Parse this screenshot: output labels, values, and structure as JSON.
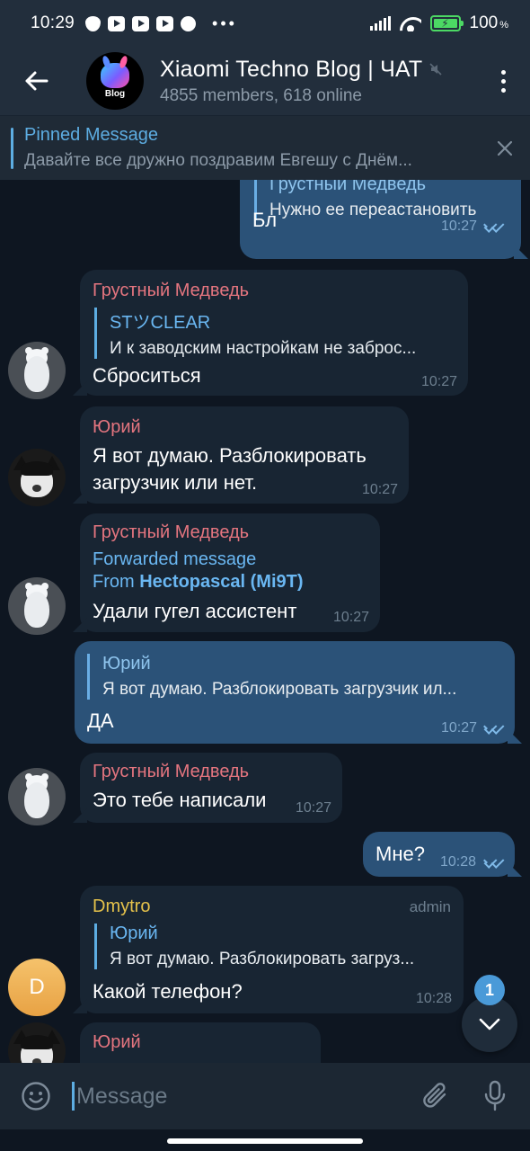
{
  "status_bar": {
    "time": "10:29",
    "battery": "100",
    "battery_unit": "%",
    "overflow": "•••"
  },
  "header": {
    "avatar_text": "Blog",
    "title": "Xiaomi Techno Blog | ЧАТ",
    "subtitle": "4855 members, 618 online"
  },
  "pinned": {
    "title": "Pinned Message",
    "preview": "Давайте все дружно поздравим Евгешу с Днём..."
  },
  "messages": [
    {
      "id": "m1",
      "direction": "out",
      "reply_name": "Грустный Медведь",
      "reply_text": "Нужно ее переастановить",
      "text": "Бл",
      "time": "10:27"
    },
    {
      "id": "m2",
      "direction": "in",
      "sender": "Грустный Медведь",
      "reply_name": "STツCLEAR",
      "reply_text": "И к заводским настройкам не заброс...",
      "text": "Сброситься",
      "time": "10:27"
    },
    {
      "id": "m3",
      "direction": "in",
      "sender": "Юрий",
      "text_line1": "Я вот думаю. Разблокировать",
      "text_line2": "загрузчик или нет.",
      "time": "10:27"
    },
    {
      "id": "m4",
      "direction": "in",
      "sender": "Грустный Медведь",
      "forward_label": "Forwarded message",
      "forward_from_prefix": "From",
      "forward_from_name": "Hectopascal (Mi9T)",
      "text": "Удали гугел ассистент",
      "time": "10:27"
    },
    {
      "id": "m5",
      "direction": "out",
      "reply_name": "Юрий",
      "reply_text": "Я вот думаю. Разблокировать загрузчик ил...",
      "text": "ДА",
      "time": "10:27"
    },
    {
      "id": "m6",
      "direction": "in",
      "sender": "Грустный Медведь",
      "text": "Это тебе написали",
      "time": "10:27"
    },
    {
      "id": "m7",
      "direction": "out",
      "text": "Мне?",
      "time": "10:28"
    },
    {
      "id": "m8",
      "direction": "in",
      "sender": "Dmytro",
      "badge": "admin",
      "avatar_letter": "D",
      "reply_name": "Юрий",
      "reply_text": "Я вот думаю. Разблокировать загруз...",
      "text": "Какой телефон?",
      "time": "10:28"
    },
    {
      "id": "m9",
      "direction": "in",
      "sender": "Юрий"
    }
  ],
  "scroll_down": {
    "unread_count": "1"
  },
  "composer": {
    "placeholder": "Message"
  },
  "colors": {
    "background": "#0e1621",
    "header": "#222e3c",
    "incoming_bubble": "#182533",
    "outgoing_bubble": "#2b5278",
    "accent": "#5dade2",
    "sender_pink": "#e4757f",
    "sender_yellow": "#e5c24b"
  },
  "icons": [
    "back-arrow-icon",
    "muted-icon",
    "more-vert-icon",
    "close-icon",
    "double-check-icon",
    "chevron-down-icon",
    "emoji-icon",
    "paperclip-icon",
    "microphone-icon"
  ]
}
